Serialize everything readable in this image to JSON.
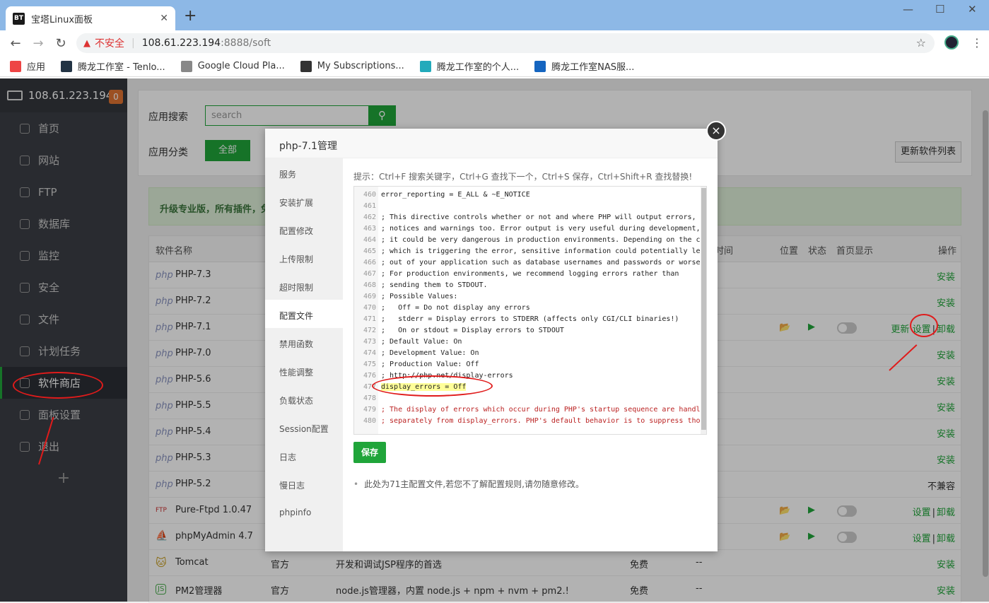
{
  "browser": {
    "tab_title": "宝塔Linux面板",
    "tab_favicon": "BT",
    "insecure_label": "不安全",
    "url_host": "108.61.223.194",
    "url_rest": ":8888/soft",
    "bookmarks": [
      {
        "label": "应用",
        "icon": "apps-grid-icon",
        "color": "#e44"
      },
      {
        "label": "腾龙工作室 - Tenlo...",
        "icon": "tenlong-icon",
        "color": "#234"
      },
      {
        "label": "Google Cloud Pla...",
        "icon": "gear-icon",
        "color": "#888"
      },
      {
        "label": "My Subscriptions...",
        "icon": "v-icon",
        "color": "#333"
      },
      {
        "label": "腾龙工作室的个人...",
        "icon": "bilibili-icon",
        "color": "#2ab"
      },
      {
        "label": "腾龙工作室NAS服...",
        "icon": "dsm-icon",
        "color": "#1565c0"
      }
    ]
  },
  "sidebar": {
    "server_ip": "108.61.223.194",
    "notify_count": "0",
    "items": [
      {
        "label": "首页",
        "icon": "home-icon"
      },
      {
        "label": "网站",
        "icon": "globe-icon"
      },
      {
        "label": "FTP",
        "icon": "ftp-icon"
      },
      {
        "label": "数据库",
        "icon": "database-icon"
      },
      {
        "label": "监控",
        "icon": "monitor-icon"
      },
      {
        "label": "安全",
        "icon": "shield-icon"
      },
      {
        "label": "文件",
        "icon": "folder-icon"
      },
      {
        "label": "计划任务",
        "icon": "calendar-icon"
      },
      {
        "label": "软件商店",
        "icon": "grid-icon"
      },
      {
        "label": "面板设置",
        "icon": "gear-icon"
      },
      {
        "label": "退出",
        "icon": "logout-icon"
      }
    ],
    "add": "+"
  },
  "soft": {
    "search_label": "应用搜索",
    "search_placeholder": "search",
    "category_label": "应用分类",
    "category_all": "全部",
    "refresh_button": "更新软件列表",
    "banner": "升级专业版，所有插件，免费"
  },
  "table": {
    "headers": {
      "name": "软件名称",
      "time": "时间",
      "location": "位置",
      "status": "状态",
      "home": "首页显示",
      "ops": "操作"
    },
    "rows": [
      {
        "icon": "php",
        "name": "PHP-7.3",
        "op": "安装"
      },
      {
        "icon": "php",
        "name": "PHP-7.2",
        "op": "安装"
      },
      {
        "icon": "php",
        "name": "PHP-7.1",
        "op_update": "更新",
        "op_settings": "设置",
        "op_sep": "|",
        "op_uninstall": "卸载"
      },
      {
        "icon": "php",
        "name": "PHP-7.0",
        "op": "安装"
      },
      {
        "icon": "php",
        "name": "PHP-5.6",
        "op": "安装"
      },
      {
        "icon": "php",
        "name": "PHP-5.5",
        "op": "安装"
      },
      {
        "icon": "php",
        "name": "PHP-5.4",
        "op": "安装"
      },
      {
        "icon": "php",
        "name": "PHP-5.3",
        "op": "安装"
      },
      {
        "icon": "php",
        "name": "PHP-5.2",
        "op": "不兼容"
      },
      {
        "icon": "FTP",
        "name": "Pure-Ftpd 1.0.47",
        "op_settings": "设置",
        "op_sep": "|",
        "op_uninstall": "卸载"
      },
      {
        "icon": "⛵",
        "name": "phpMyAdmin 4.7",
        "op_settings": "设置",
        "op_sep": "|",
        "op_uninstall": "卸载"
      },
      {
        "icon": "🐱",
        "name": "Tomcat",
        "dev": "官方",
        "desc": "开发和调试JSP程序的首选",
        "price": "免费",
        "expire": "--",
        "op": "安装"
      },
      {
        "icon": "JS",
        "name": "PM2管理器",
        "dev": "官方",
        "desc": "node.js管理器，内置 node.js + npm + nvm + pm2.!",
        "price": "免费",
        "expire": "--",
        "op": "安装"
      }
    ]
  },
  "modal": {
    "title": "php-7.1管理",
    "close": "×",
    "nav": [
      "服务",
      "安装扩展",
      "配置修改",
      "上传限制",
      "超时限制",
      "配置文件",
      "禁用函数",
      "性能调整",
      "负载状态",
      "Session配置",
      "日志",
      "慢日志",
      "phpinfo"
    ],
    "tip": "提示：Ctrl+F 搜索关键字，Ctrl+G 查找下一个，Ctrl+S 保存，Ctrl+Shift+R 查找替换!",
    "save": "保存",
    "note": "此处为71主配置文件,若您不了解配置规则,请勿随意修改。",
    "lines": [
      {
        "n": "460",
        "t": "error_reporting = E_ALL & ~E_NOTICE"
      },
      {
        "n": "461",
        "t": ""
      },
      {
        "n": "462",
        "t": "; This directive controls whether or not and where PHP will output errors,"
      },
      {
        "n": "463",
        "t": "; notices and warnings too. Error output is very useful during development,"
      },
      {
        "n": "464",
        "t": "; it could be very dangerous in production environments. Depending on the c"
      },
      {
        "n": "465",
        "t": "; which is triggering the error, sensitive information could potentially le"
      },
      {
        "n": "466",
        "t": "; out of your application such as database usernames and passwords or worse"
      },
      {
        "n": "467",
        "t": "; For production environments, we recommend logging errors rather than"
      },
      {
        "n": "468",
        "t": "; sending them to STDOUT."
      },
      {
        "n": "469",
        "t": "; Possible Values:"
      },
      {
        "n": "470",
        "t": ";   Off = Do not display any errors"
      },
      {
        "n": "471",
        "t": ";   stderr = Display errors to STDERR (affects only CGI/CLI binaries!)"
      },
      {
        "n": "472",
        "t": ";   On or stdout = Display errors to STDOUT"
      },
      {
        "n": "473",
        "t": "; Default Value: On"
      },
      {
        "n": "474",
        "t": "; Development Value: On"
      },
      {
        "n": "475",
        "t": "; Production Value: Off"
      },
      {
        "n": "476",
        "t": "; http://php.net/display-errors"
      },
      {
        "n": "477",
        "t": "display_errors = Off"
      },
      {
        "n": "478",
        "t": ""
      },
      {
        "n": "479",
        "t": "; The display of errors which occur during PHP's startup sequence are handl"
      },
      {
        "n": "480",
        "t": "; separately from display_errors. PHP's default behavior is to suppress tho"
      }
    ]
  },
  "colors": {
    "accent": "#20a53a",
    "annotation": "#e01b1b",
    "sidebar_bg": "#3b3e45"
  }
}
